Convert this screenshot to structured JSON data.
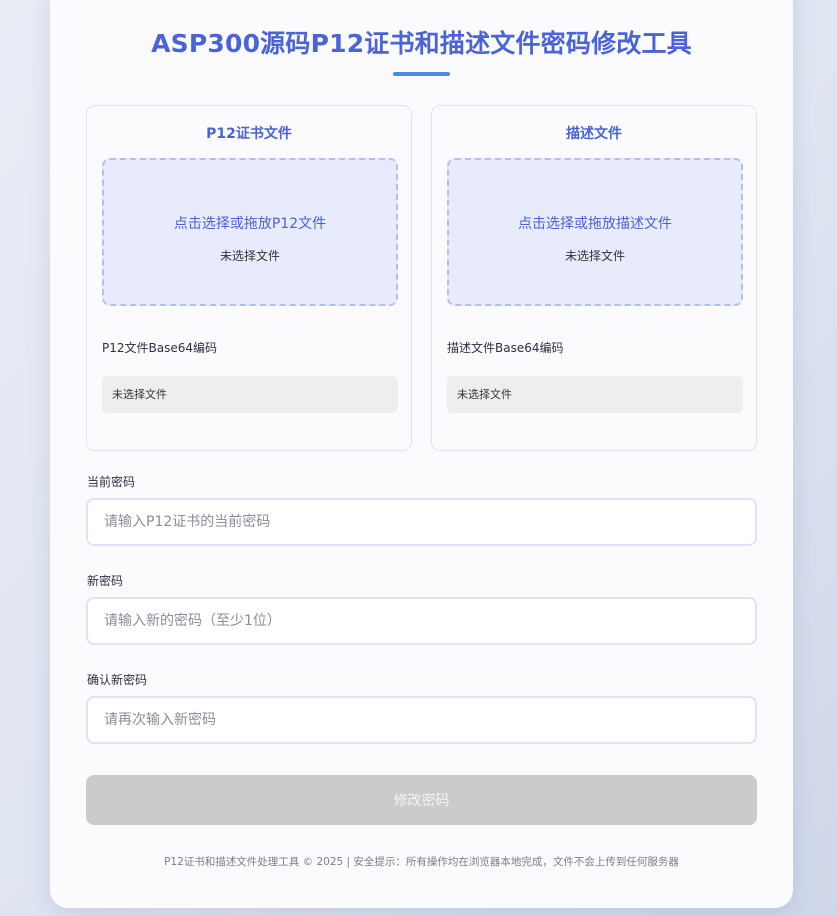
{
  "page": {
    "title": "ASP300源码P12证书和描述文件密码修改工具",
    "footer": "P12证书和描述文件处理工具 © 2025 | 安全提示：所有操作均在浏览器本地完成，文件不会上传到任何服务器"
  },
  "p12": {
    "title": "P12证书文件",
    "drop_prompt": "点击选择或拖放P12文件",
    "status": "未选择文件",
    "base64_label": "P12文件Base64编码",
    "base64_value": "未选择文件"
  },
  "profile": {
    "title": "描述文件",
    "drop_prompt": "点击选择或拖放描述文件",
    "status": "未选择文件",
    "base64_label": "描述文件Base64编码",
    "base64_value": "未选择文件"
  },
  "form": {
    "current_password": {
      "label": "当前密码",
      "placeholder": "请输入P12证书的当前密码",
      "value": ""
    },
    "new_password": {
      "label": "新密码",
      "placeholder": "请输入新的密码（至少1位）",
      "value": ""
    },
    "confirm_password": {
      "label": "确认新密码",
      "placeholder": "请再次输入新密码",
      "value": ""
    },
    "submit_label": "修改密码"
  },
  "colors": {
    "accent": "#4a63d8",
    "underline": "#4a8ae8",
    "dropzone_bg": "#e8ebfb",
    "button_disabled": "#cbcbcd"
  }
}
